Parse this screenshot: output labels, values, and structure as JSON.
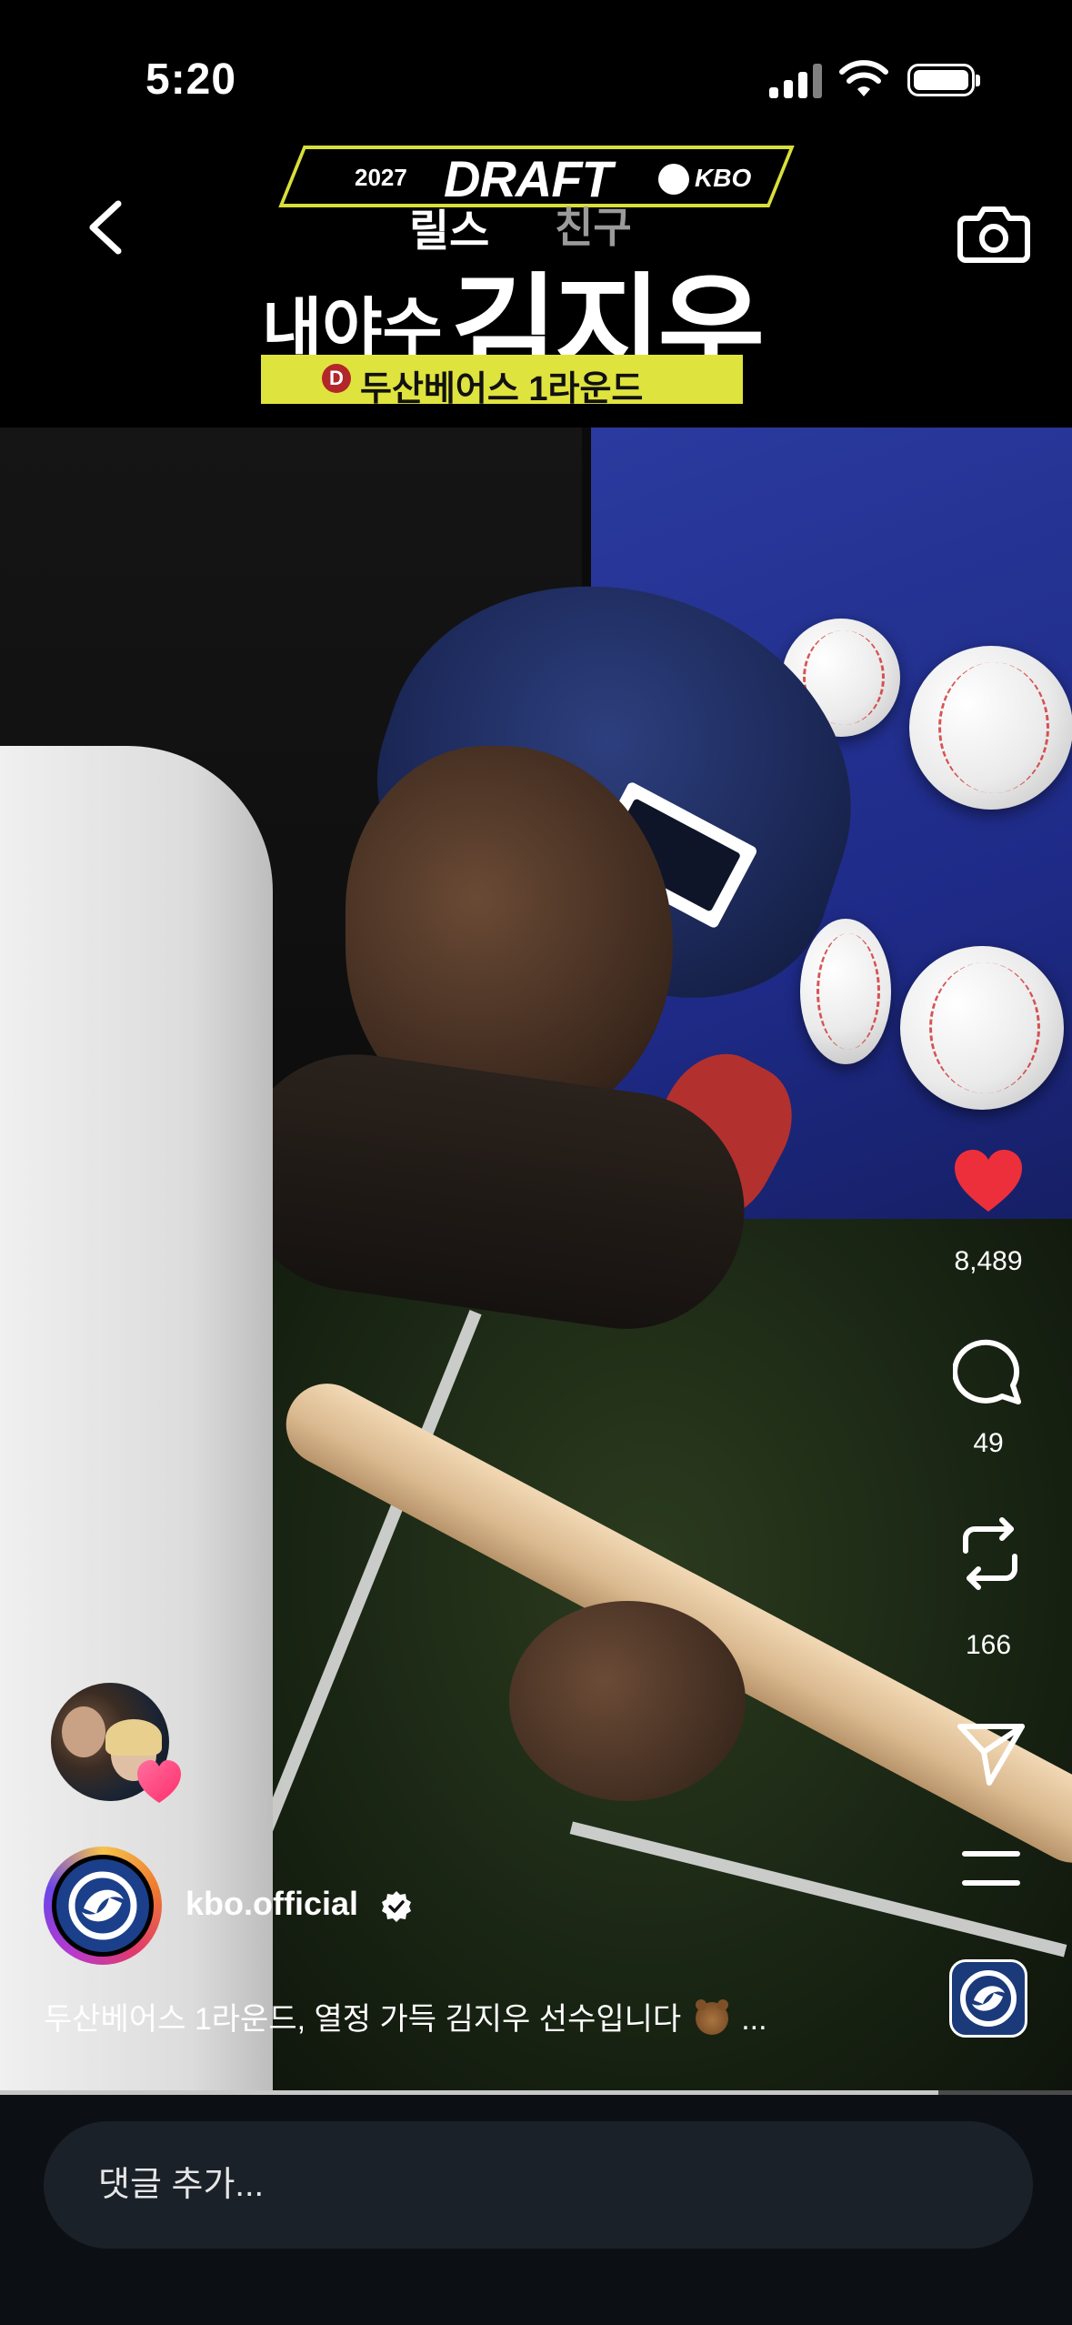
{
  "status_bar": {
    "time": "5:20"
  },
  "video_title": {
    "year": "2027",
    "draft": "DRAFT",
    "league": "KBO",
    "line1_a": "릴스",
    "line1_b": "친구",
    "position": "내야수",
    "player_name": "김지우",
    "team_icon_letter": "D",
    "team_round": "두산베어스 1라운드"
  },
  "actions": {
    "likes": "8,489",
    "comments": "49",
    "reposts": "166"
  },
  "post": {
    "username": "kbo.official",
    "caption_text": "두산베어스 1라운드, 열정 가득 김지우 선수입니다",
    "caption_more": "..."
  },
  "playback": {
    "progress": 0.875
  },
  "comment_bar": {
    "placeholder": "댓글 추가..."
  },
  "colors": {
    "like": "#ed2f3b",
    "title_accent": "#dfe33e",
    "background": "#0c1014"
  },
  "icons": [
    "back-arrow-icon",
    "camera-icon",
    "heart-icon",
    "comment-icon",
    "repost-icon",
    "send-icon",
    "menu-icon",
    "verified-icon"
  ]
}
